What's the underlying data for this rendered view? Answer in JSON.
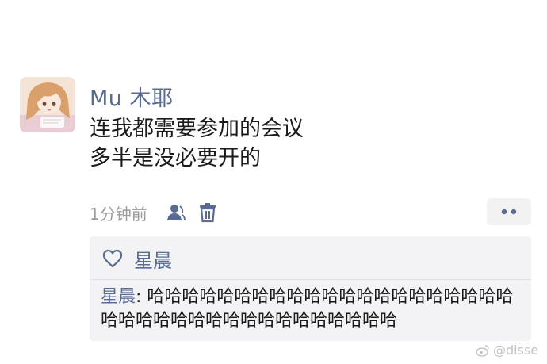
{
  "post": {
    "author": "Mu 木耶",
    "content_lines": [
      "连我都需要参加的会议",
      "多半是没必要开的"
    ],
    "time": "1分钟前"
  },
  "interactions": {
    "likers": "星晨",
    "comment": {
      "author": "星晨",
      "separator": ": ",
      "text": "哈哈哈哈哈哈哈哈哈哈哈哈哈哈哈哈哈哈哈哈哈哈哈哈哈哈哈哈哈哈哈哈哈哈哈哈哈哈"
    }
  },
  "watermark": {
    "handle": "@disse",
    "icon": "weibo-icon"
  },
  "icons": {
    "visibility": "person-icon",
    "delete": "trash-icon",
    "more": "more-dots-icon",
    "like": "heart-outline-icon"
  },
  "colors": {
    "link": "#576b95",
    "text": "#1a1a1a",
    "meta": "#9a9a9a",
    "panel": "#f3f3f5"
  }
}
